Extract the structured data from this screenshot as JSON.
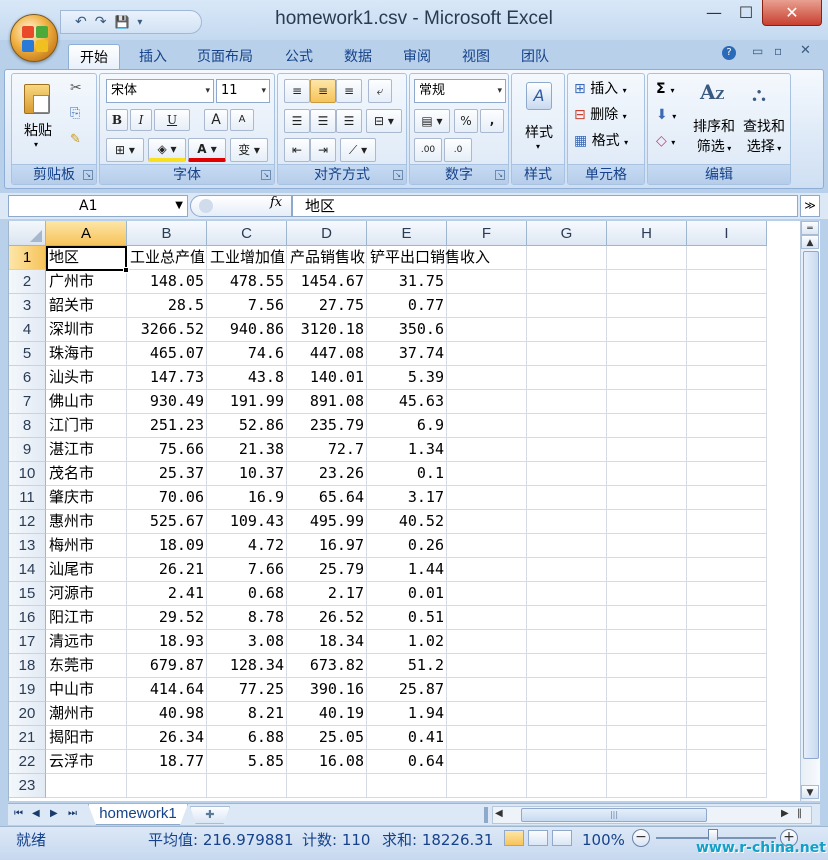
{
  "window": {
    "title": "homework1.csv - Microsoft Excel",
    "minimize": "—",
    "maximize": "☐",
    "close": "✕"
  },
  "qat": {
    "undo": "↶",
    "redo": "↷",
    "save": "💾",
    "more": "▾"
  },
  "tabs": [
    "开始",
    "插入",
    "页面布局",
    "公式",
    "数据",
    "审阅",
    "视图",
    "团队"
  ],
  "ribbon": {
    "clipboard": {
      "label": "剪贴板",
      "paste": "粘贴"
    },
    "font": {
      "label": "字体",
      "name": "宋体",
      "size": "11",
      "bold": "B",
      "italic": "I",
      "underline": "U",
      "grow": "A",
      "shrink": "A",
      "phonetic": "变"
    },
    "align": {
      "label": "对齐方式"
    },
    "number": {
      "label": "数字",
      "format": "常规",
      "percent": "%",
      "comma": ",",
      "inc": ".00",
      "dec": ".0"
    },
    "styles": {
      "label": "样式",
      "button": "样式"
    },
    "cells": {
      "label": "单元格",
      "insert": "插入",
      "delete": "删除",
      "format": "格式"
    },
    "editing": {
      "label": "编辑",
      "sort": "排序和",
      "sort2": "筛选",
      "find": "查找和",
      "find2": "选择"
    }
  },
  "formula_bar": {
    "name_box": "A1",
    "fx": "fx",
    "content": "地区"
  },
  "columns": [
    "A",
    "B",
    "C",
    "D",
    "E",
    "F",
    "G",
    "H",
    "I"
  ],
  "rows": [
    [
      "地区",
      "工业总产值",
      "工业增加值",
      "产品销售收入",
      "铲平出口销售收入"
    ],
    [
      "广州市",
      "148.05",
      "478.55",
      "1454.67",
      "31.75"
    ],
    [
      "韶关市",
      "28.5",
      "7.56",
      "27.75",
      "0.77"
    ],
    [
      "深圳市",
      "3266.52",
      "940.86",
      "3120.18",
      "350.6"
    ],
    [
      "珠海市",
      "465.07",
      "74.6",
      "447.08",
      "37.74"
    ],
    [
      "汕头市",
      "147.73",
      "43.8",
      "140.01",
      "5.39"
    ],
    [
      "佛山市",
      "930.49",
      "191.99",
      "891.08",
      "45.63"
    ],
    [
      "江门市",
      "251.23",
      "52.86",
      "235.79",
      "6.9"
    ],
    [
      "湛江市",
      "75.66",
      "21.38",
      "72.7",
      "1.34"
    ],
    [
      "茂名市",
      "25.37",
      "10.37",
      "23.26",
      "0.1"
    ],
    [
      "肇庆市",
      "70.06",
      "16.9",
      "65.64",
      "3.17"
    ],
    [
      "惠州市",
      "525.67",
      "109.43",
      "495.99",
      "40.52"
    ],
    [
      "梅州市",
      "18.09",
      "4.72",
      "16.97",
      "0.26"
    ],
    [
      "汕尾市",
      "26.21",
      "7.66",
      "25.79",
      "1.44"
    ],
    [
      "河源市",
      "2.41",
      "0.68",
      "2.17",
      "0.01"
    ],
    [
      "阳江市",
      "29.52",
      "8.78",
      "26.52",
      "0.51"
    ],
    [
      "清远市",
      "18.93",
      "3.08",
      "18.34",
      "1.02"
    ],
    [
      "东莞市",
      "679.87",
      "128.34",
      "673.82",
      "51.2"
    ],
    [
      "中山市",
      "414.64",
      "77.25",
      "390.16",
      "25.87"
    ],
    [
      "潮州市",
      "40.98",
      "8.21",
      "40.19",
      "1.94"
    ],
    [
      "揭阳市",
      "26.34",
      "6.88",
      "25.05",
      "0.41"
    ],
    [
      "云浮市",
      "18.77",
      "5.85",
      "16.08",
      "0.64"
    ],
    []
  ],
  "sheet_tabs": {
    "active": "homework1"
  },
  "status": {
    "ready": "就绪",
    "average": "平均值: 216.979881",
    "count": "计数: 110",
    "sum": "求和: 18226.31",
    "zoom": "100%",
    "zoom_minus": "−",
    "zoom_plus": "+"
  },
  "watermark": "www.r-china.net"
}
